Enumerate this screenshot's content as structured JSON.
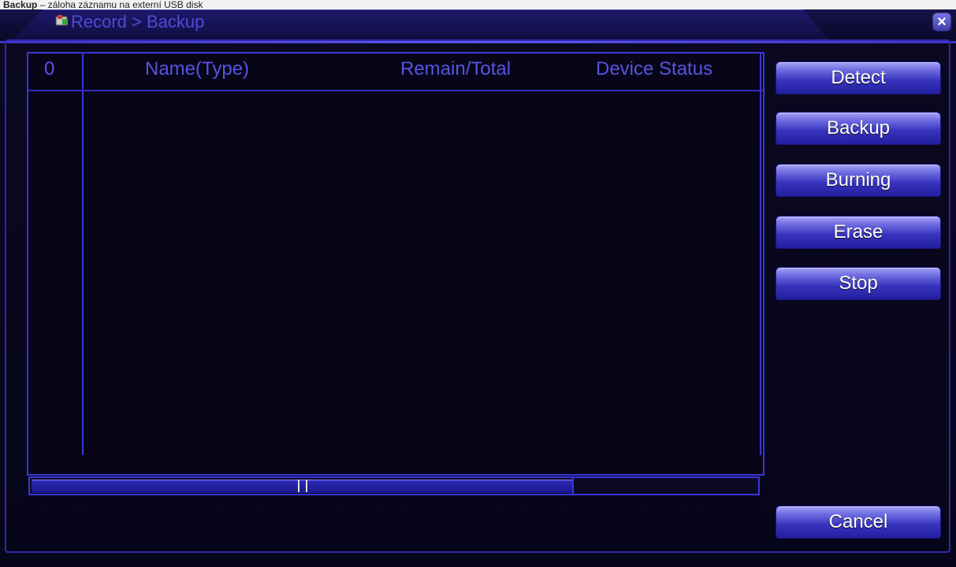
{
  "caption": {
    "bold": "Backup",
    "rest": " – záloha záznamu na externí USB disk"
  },
  "window": {
    "title": "Record > Backup",
    "close_label": "×"
  },
  "table": {
    "columns": [
      "0",
      "Name(Type)",
      "Remain/Total",
      "Device Status"
    ],
    "rows": []
  },
  "buttons": {
    "detect": "Detect",
    "backup": "Backup",
    "burning": "Burning",
    "erase": "Erase",
    "stop": "Stop",
    "cancel": "Cancel"
  },
  "colors": {
    "background": "#0a0717",
    "accent": "#3935d8",
    "title_text": "#4f4bd6",
    "button": "#3733bd"
  }
}
